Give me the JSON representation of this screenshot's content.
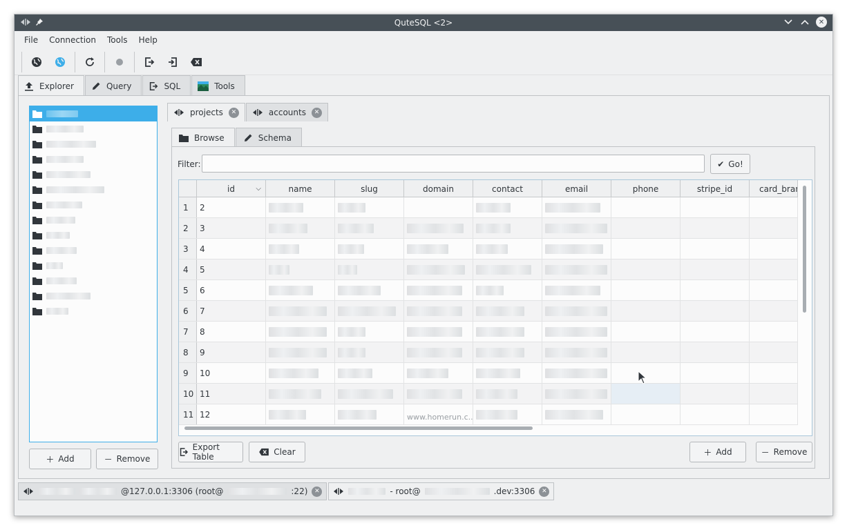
{
  "window": {
    "title": "QuteSQL <2>"
  },
  "menubar": {
    "items": [
      "File",
      "Connection",
      "Tools",
      "Help"
    ]
  },
  "toolbar": {
    "icons": [
      "globe-icon",
      "globe-colored-icon",
      "refresh-icon",
      "record-icon",
      "export-icon",
      "import-icon",
      "clear-icon"
    ]
  },
  "main_tabs": [
    {
      "label": "Explorer",
      "active": true
    },
    {
      "label": "Query",
      "active": false
    },
    {
      "label": "SQL",
      "active": false
    },
    {
      "label": "Tools",
      "active": false
    }
  ],
  "database_list": {
    "count": 14,
    "selected_index": 0
  },
  "db_buttons": {
    "add": "Add",
    "remove": "Remove"
  },
  "table_tabs": [
    {
      "label": "projects",
      "active": true
    },
    {
      "label": "accounts",
      "active": false
    }
  ],
  "sub_tabs": [
    {
      "label": "Browse",
      "active": true
    },
    {
      "label": "Schema",
      "active": false
    }
  ],
  "filter": {
    "label": "Filter:",
    "value": "",
    "go_label": "Go!"
  },
  "grid": {
    "columns": [
      "id",
      "name",
      "slug",
      "domain",
      "contact",
      "email",
      "phone",
      "stripe_id",
      "card_bran"
    ],
    "rows": [
      {
        "rownum": "1",
        "id": "2"
      },
      {
        "rownum": "2",
        "id": "3"
      },
      {
        "rownum": "3",
        "id": "4"
      },
      {
        "rownum": "4",
        "id": "5"
      },
      {
        "rownum": "5",
        "id": "6"
      },
      {
        "rownum": "6",
        "id": "7"
      },
      {
        "rownum": "7",
        "id": "8"
      },
      {
        "rownum": "8",
        "id": "9"
      },
      {
        "rownum": "9",
        "id": "10"
      },
      {
        "rownum": "10",
        "id": "11"
      },
      {
        "rownum": "11",
        "id": "12"
      }
    ],
    "partial_text": "www.homerun.c..."
  },
  "bottom_buttons": {
    "export": "Export Table",
    "clear": "Clear",
    "add": "Add",
    "remove": "Remove"
  },
  "connections": [
    {
      "label": "@127.0.0.1:3306 (root@",
      "label_tail": ":22)",
      "active": false
    },
    {
      "label": "- root@",
      "label_tail": ".dev:3306",
      "active": true
    }
  ]
}
